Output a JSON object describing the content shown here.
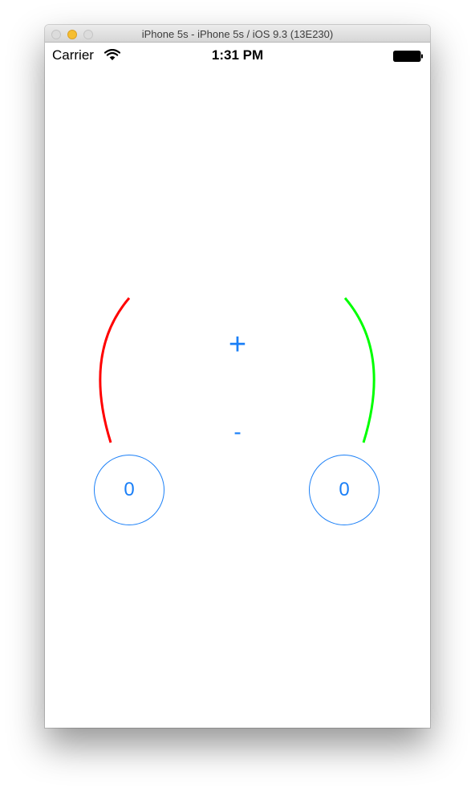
{
  "window": {
    "title": "iPhone 5s - iPhone 5s / iOS 9.3 (13E230)"
  },
  "status_bar": {
    "carrier": "Carrier",
    "time": "1:31 PM",
    "wifi_icon": "wifi-icon",
    "battery_icon": "battery-icon"
  },
  "controls": {
    "plus_label": "+",
    "minus_label": "-"
  },
  "counters": {
    "left_value": "0",
    "right_value": "0"
  },
  "colors": {
    "accent": "#1a7ff7",
    "left_arc": "#ff0000",
    "right_arc": "#00ff00"
  }
}
